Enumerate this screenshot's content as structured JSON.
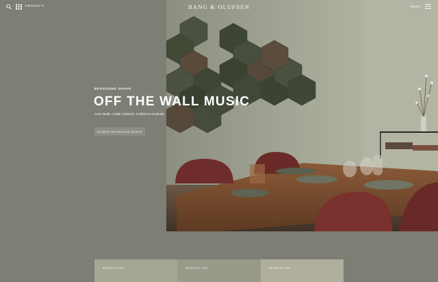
{
  "header": {
    "products_label": "PRODOTTI",
    "brand": "BANG & OLUFSEN",
    "menu_label": "MENU"
  },
  "hero": {
    "eyebrow": "BEOSOUND SHAPE",
    "title": "OFF THE WALL MUSIC",
    "description": "Ama l'audio. Goditi il silenzio. Celebra la creatività.",
    "cta_label": "SCOPRI BEOSOUND SHAPE"
  },
  "tiles": [
    {
      "label": "BEOPLAY H4",
      "color": "#a5a694"
    },
    {
      "label": "BEOPLAY H8I",
      "color": "#999a89"
    },
    {
      "label": "BEOPLAY H9I",
      "color": "#b0ae9c"
    }
  ],
  "colors": {
    "page_bg": "#7d7e74",
    "cta_bg": "#8d8e85"
  }
}
